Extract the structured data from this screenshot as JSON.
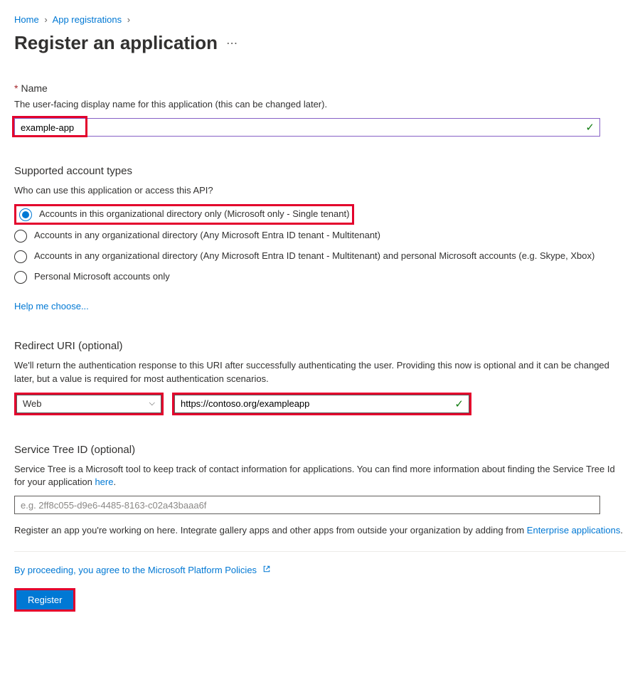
{
  "breadcrumb": {
    "home": "Home",
    "appreg": "App registrations"
  },
  "title": "Register an application",
  "name": {
    "label": "Name",
    "desc": "The user-facing display name for this application (this can be changed later).",
    "value": "example-app"
  },
  "accountTypes": {
    "heading": "Supported account types",
    "desc": "Who can use this application or access this API?",
    "options": [
      "Accounts in this organizational directory only (Microsoft only - Single tenant)",
      "Accounts in any organizational directory (Any Microsoft Entra ID tenant - Multitenant)",
      "Accounts in any organizational directory (Any Microsoft Entra ID tenant - Multitenant) and personal Microsoft accounts (e.g. Skype, Xbox)",
      "Personal Microsoft accounts only"
    ],
    "helpLink": "Help me choose..."
  },
  "redirect": {
    "heading": "Redirect URI (optional)",
    "desc": "We'll return the authentication response to this URI after successfully authenticating the user. Providing this now is optional and it can be changed later, but a value is required for most authentication scenarios.",
    "platform": "Web",
    "uri": "https://contoso.org/exampleapp"
  },
  "serviceTree": {
    "heading": "Service Tree ID (optional)",
    "descPrefix": "Service Tree is a Microsoft tool to keep track of contact information for applications. You can find more information about finding the Service Tree Id for your application ",
    "hereLink": "here",
    "placeholder": "e.g. 2ff8c055-d9e6-4485-8163-c02a43baaa6f"
  },
  "footnote": {
    "prefix": "Register an app you're working on here. Integrate gallery apps and other apps from outside your organization by adding from ",
    "link": "Enterprise applications"
  },
  "agree": "By proceeding, you agree to the Microsoft Platform Policies",
  "registerBtn": "Register"
}
